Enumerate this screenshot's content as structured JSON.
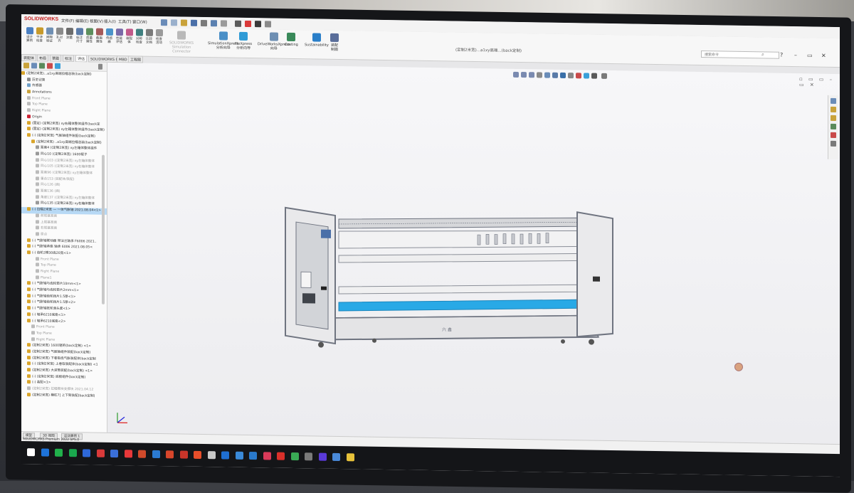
{
  "app": {
    "logo": "SOLIDWORKS",
    "menus": [
      "文件(F)",
      "编辑(E)",
      "视图(V)",
      "插入(I)",
      "工具(T)",
      "窗口(W)"
    ],
    "document_title": "(定制2米宽)...a1xy高端...(back定制)",
    "search_placeholder": "搜索命令",
    "window_controls": [
      "?",
      "–",
      "▭",
      "✕"
    ]
  },
  "commands": {
    "small": [
      {
        "label": "设计\n算例",
        "color": "#4a7fc1"
      },
      {
        "label": "干涉\n检查",
        "color": "#c79a2a"
      },
      {
        "label": "间隙\n验证",
        "color": "#6f8fb3"
      },
      {
        "label": "孔对\n齐",
        "color": "#8a8a8a"
      },
      {
        "label": "测量",
        "color": "#6c6c6c"
      },
      {
        "label": "标注\n尺寸",
        "color": "#5a7ba8"
      },
      {
        "label": "质量\n属性",
        "color": "#5d8f5d"
      },
      {
        "label": "截面\n属性",
        "color": "#a55a5a"
      },
      {
        "label": "传感\n器",
        "color": "#4b93c9"
      },
      {
        "label": "性能\n评估",
        "color": "#7a6aa8"
      },
      {
        "label": "装配\n体",
        "color": "#c15a8a"
      },
      {
        "label": "对称\n检查",
        "color": "#3f7f7f"
      },
      {
        "label": "比较\n文档",
        "color": "#7a7a7a"
      },
      {
        "label": "检查\n活动",
        "color": "#9a9a9a"
      }
    ],
    "big": [
      {
        "label": "SOLIDWORKS\nSimulation\nConnector",
        "color": "#b9b9b9"
      },
      {
        "label": "SimulationXpress\n分析向导",
        "color": "#4a8fc7"
      },
      {
        "label": "FloXpress\n分析向导",
        "color": "#2f9bd6"
      },
      {
        "label": "DriveWorksXpress\n向导",
        "color": "#6e8fb3"
      },
      {
        "label": "Costing",
        "color": "#3a8a5a"
      },
      {
        "label": "Sustainability",
        "color": "#2a7fc9"
      },
      {
        "label": "装配\n制图",
        "color": "#5a6e9a"
      }
    ]
  },
  "tabs": [
    "装配体",
    "布局",
    "草图",
    "标注",
    "评估",
    "SOLIDWORKS 插件",
    "MBD",
    "工程图"
  ],
  "active_tab": "评估",
  "tree": {
    "root": "(定制2米宽)...a1xy高端拉幅总装(back定制)",
    "rows": [
      {
        "text": "历史记录",
        "indent": 1,
        "color": "#888"
      },
      {
        "text": "传感器",
        "indent": 1,
        "color": "#6fa0c9"
      },
      {
        "text": "Annotations",
        "indent": 1,
        "color": "#c9a23a"
      },
      {
        "text": "Front Plane",
        "indent": 1,
        "color": "#bbb"
      },
      {
        "text": "Top Plane",
        "indent": 1,
        "color": "#bbb"
      },
      {
        "text": "Right Plane",
        "indent": 1,
        "color": "#bbb"
      },
      {
        "text": "Origin",
        "indent": 1,
        "color": "#c23"
      },
      {
        "text": "(固定) (定制2米宽) xy右箱体整体组件(back定",
        "indent": 1,
        "color": "#d9a52a"
      },
      {
        "text": "(固定) (定制2米宽) xy左箱体整体组件(back定制)",
        "indent": 1,
        "color": "#d9a52a"
      },
      {
        "text": "(-) (定制2米宽) 气胀轴组件装配(back定制)",
        "indent": 1,
        "color": "#d9a52a"
      },
      {
        "text": "(定制2米宽) ..a1xy高端拉幅总装(back定制)",
        "indent": 2,
        "color": "#d9a52a"
      },
      {
        "text": "距离4 ((定制2米宽) xy左箱体整体组件",
        "indent": 3,
        "color": "#999"
      },
      {
        "text": "同心10 ((定制2米宽) 1600辊子",
        "indent": 3,
        "color": "#999"
      },
      {
        "text": "同心103 ((定制2米宽) xy左箱体整体",
        "indent": 3,
        "color": "#bbb"
      },
      {
        "text": "同心105 ((定制2米宽) xy右箱体整体",
        "indent": 3,
        "color": "#bbb"
      },
      {
        "text": "距离96 ((定制2米宽) xy左箱体整体",
        "indent": 3,
        "color": "#bbb"
      },
      {
        "text": "重合153 (装配体/装配)",
        "indent": 3,
        "color": "#bbb"
      },
      {
        "text": "同心126 (面)",
        "indent": 3,
        "color": "#bbb"
      },
      {
        "text": "距离136 (面)",
        "indent": 3,
        "color": "#bbb"
      },
      {
        "text": "角度137 ((定制2米宽) xy左箱体整体",
        "indent": 3,
        "color": "#bbb"
      },
      {
        "text": "同心135 ((定制2米宽) xy右箱体整体",
        "indent": 3,
        "color": "#999"
      },
      {
        "text": "(-) 拉幅2米宽 — 一体气胀轴 2021.08.04<1>",
        "indent": 1,
        "color": "#d9a52a",
        "selected": true
      },
      {
        "text": "前视基准面",
        "indent": 3,
        "color": "#bbb"
      },
      {
        "text": "上视基准面",
        "indent": 3,
        "color": "#bbb"
      },
      {
        "text": "右视基准面",
        "indent": 3,
        "color": "#bbb"
      },
      {
        "text": "原点",
        "indent": 3,
        "color": "#bbb"
      },
      {
        "text": "(-) 气胀轴联动器 带法兰轴承 F6006 2021..",
        "indent": 1,
        "color": "#d9a52a"
      },
      {
        "text": "(-) 气胀轴承座 轴承 6006 2021.08.05<",
        "indent": 1,
        "color": "#d9a52a"
      },
      {
        "text": "(-) 齿轮2模30齿20宽<1>",
        "indent": 1,
        "color": "#d9a52a"
      },
      {
        "text": "Front Plane",
        "indent": 3,
        "color": "#bbb"
      },
      {
        "text": "Top Plane",
        "indent": 3,
        "color": "#bbb"
      },
      {
        "text": "Right Plane",
        "indent": 3,
        "color": "#bbb"
      },
      {
        "text": "Plane1",
        "indent": 3,
        "color": "#bbb"
      },
      {
        "text": "(-) 气胀轴与齿轮垫片10mm<1>",
        "indent": 1,
        "color": "#d9a52a"
      },
      {
        "text": "(-) 气胀轴与齿轮垫片2mm<1>",
        "indent": 1,
        "color": "#d9a52a"
      },
      {
        "text": "(-) 气胀轴齿轮挡片1.5厚<1>",
        "indent": 1,
        "color": "#d9a52a"
      },
      {
        "text": "(-) 气胀轴齿轮挡片1.5厚<2>",
        "indent": 1,
        "color": "#d9a52a"
      },
      {
        "text": "(-) 气胀轴抵轮滑头套<1>",
        "indent": 1,
        "color": "#d9a52a"
      },
      {
        "text": "(-) 轴承6210底座<1>",
        "indent": 1,
        "color": "#d9a52a"
      },
      {
        "text": "(-) 轴承6210底座<2>",
        "indent": 1,
        "color": "#d9a52a"
      },
      {
        "text": "Front Plane",
        "indent": 2,
        "color": "#bbb"
      },
      {
        "text": "Top Plane",
        "indent": 2,
        "color": "#bbb"
      },
      {
        "text": "Right Plane",
        "indent": 2,
        "color": "#bbb"
      },
      {
        "text": "(定制2米宽) 1600辊的(back定制) <1>",
        "indent": 1,
        "color": "#d9a52a"
      },
      {
        "text": "(定制2米宽) 气胀轴组件装配(back定制)",
        "indent": 1,
        "color": "#d9a52a"
      },
      {
        "text": "(定制2米宽) 下卷取齿气胀装配体(back定制",
        "indent": 1,
        "color": "#d9a52a"
      },
      {
        "text": "(-) (定制2米宽) 上卷取装配体(back定制) <1",
        "indent": 1,
        "color": "#d9a52a"
      },
      {
        "text": "(定制2米宽) 大滚筒装配(back定制) <1>",
        "indent": 1,
        "color": "#d9a52a"
      },
      {
        "text": "(-) (定制2米宽) 底板组件(back定制)",
        "indent": 1,
        "color": "#d9a52a"
      },
      {
        "text": "(-) 装配<1>",
        "indent": 1,
        "color": "#d9a52a"
      },
      {
        "text": "(定制2米宽) 拉幅模块支撑块 2021.04.12",
        "indent": 1,
        "color": "#bbb"
      },
      {
        "text": "(定制2米宽) 横杠7] 上下架装配(back定制)",
        "indent": 1,
        "color": "#d9a52a"
      }
    ]
  },
  "statusbar": {
    "tabs": [
      "模型",
      "3D 视图",
      "运动算例 1"
    ],
    "version": "SOLIDWORKS Premium 2022 SP5.0"
  },
  "model": {
    "frame_color": "#6f7480",
    "highlight_color": "#29a9e6",
    "panel_label": "六 鑫"
  },
  "taskbar": {
    "icons": [
      "#ffffff",
      "#1e73d9",
      "#21b14b",
      "#1aa84e",
      "#2e68d8",
      "#d93a3a",
      "#3a6fd9",
      "#e8383a",
      "#d14a2b",
      "#2b7ad1",
      "#d8462b",
      "#c9352a",
      "#e84e2a",
      "#c9c9c9",
      "#1f6fd1",
      "#3a8ad9",
      "#2a7acc",
      "#d93a5a",
      "#d9302a",
      "#3aaa55",
      "#7a7a7a",
      "#5a3ad9",
      "#4a8ad9",
      "#e8c23a"
    ]
  }
}
